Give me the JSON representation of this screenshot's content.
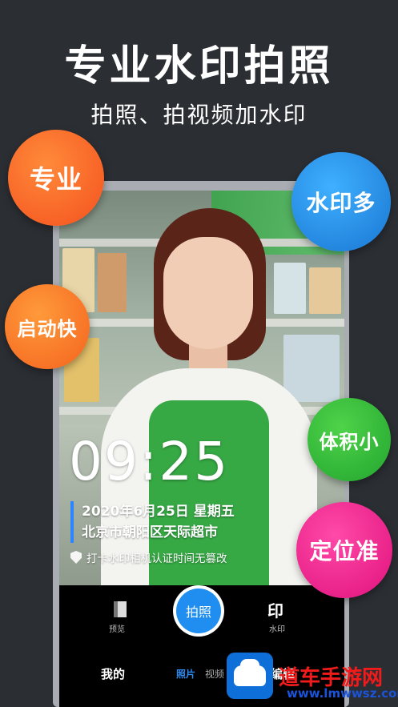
{
  "promo": {
    "headline": "专业水印拍照",
    "subheadline": "拍照、拍视频加水印"
  },
  "badges": {
    "professional": "专业",
    "many_watermarks": "水印多",
    "fast_start": "启动快",
    "small_size": "体积小",
    "accurate_location": "定位准"
  },
  "watermark": {
    "time": "09:25",
    "date_line": "2020年6月25日 星期五",
    "location": "北京市朝阳区天际超市",
    "note": "打卡水印相机认证时间无篡改"
  },
  "camera": {
    "preview_label": "预览",
    "shutter_label": "拍照",
    "watermark_icon": "印",
    "watermark_label": "水印"
  },
  "tabs": {
    "mine": "我的",
    "photo": "照片",
    "video": "视频",
    "edit": "编辑"
  },
  "site_logo": {
    "name": "道车手游网",
    "url": "www.lmwwsz.com"
  },
  "colors": {
    "background": "#2b2e33",
    "shutter_blue": "#1f8ef0",
    "watermark_bar": "#2e86ff"
  }
}
